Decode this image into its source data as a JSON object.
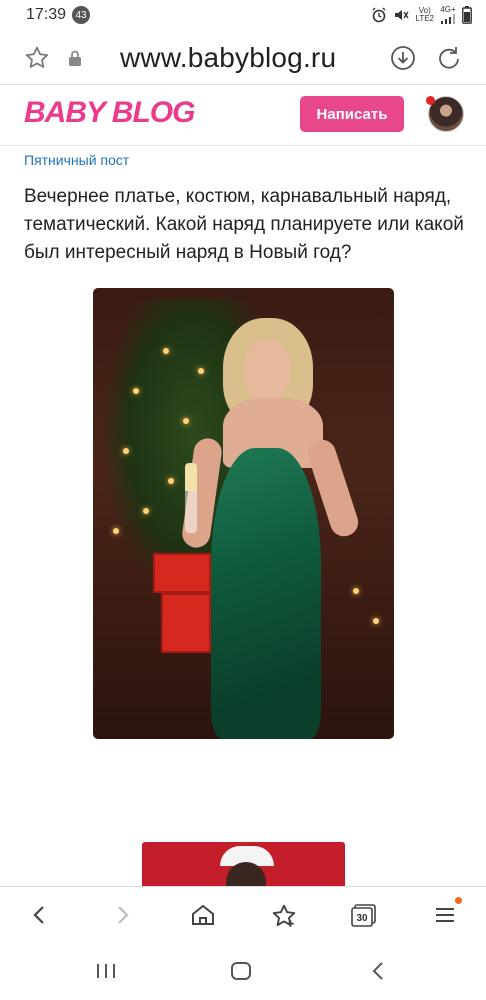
{
  "status_bar": {
    "time": "17:39",
    "notification_count": "43",
    "network_top": "Vo)",
    "network_bottom": "LTE2",
    "network_type": "4G+"
  },
  "browser": {
    "url": "www.babyblog.ru"
  },
  "site": {
    "logo": "BABY BLOG",
    "write_button": "Написать",
    "brand_color": "#e9478b"
  },
  "post": {
    "category": "Пятничный пост",
    "text": "Вечернее платье, костюм, карнавальный наряд, тематический. Какой наряд планируете или какой был интересный наряд в Новый год?"
  },
  "browser_nav": {
    "tabs_count": "30"
  }
}
